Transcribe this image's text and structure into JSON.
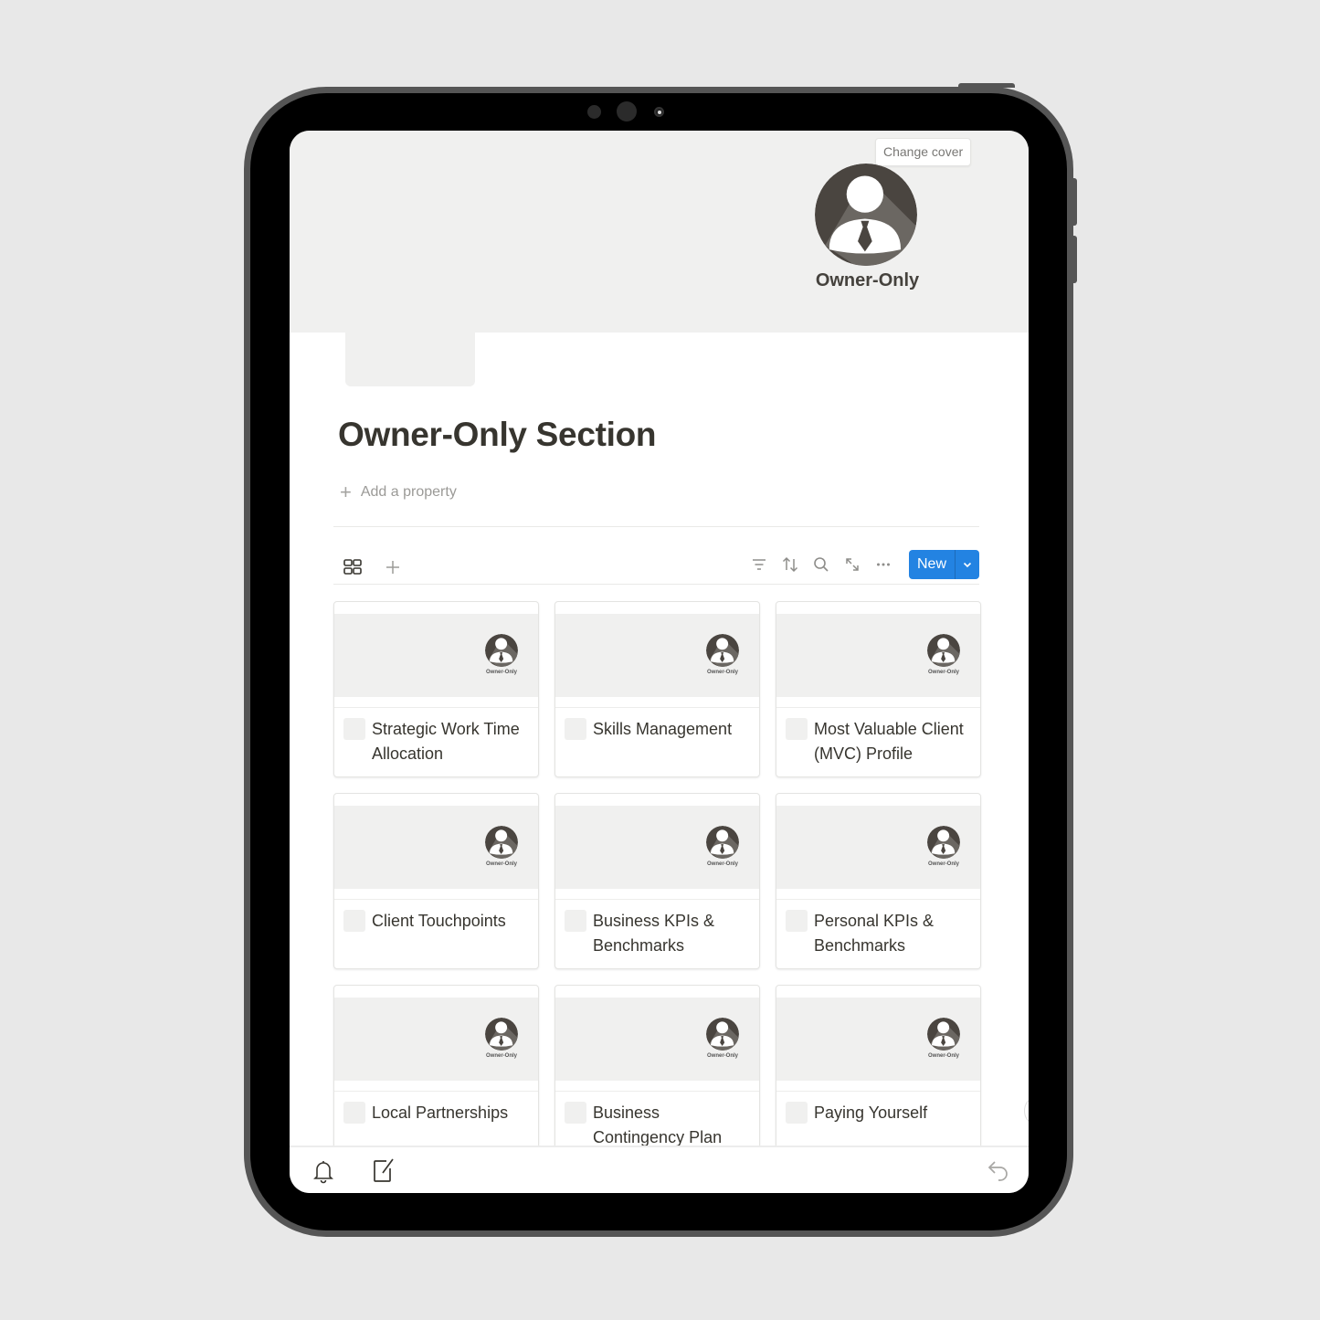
{
  "cover": {
    "change_cover_label": "Change cover",
    "logo_text": "Owner-Only",
    "logo_icon": "businessman-avatar-icon"
  },
  "page": {
    "title": "Owner-Only Section",
    "add_property_label": "Add a property"
  },
  "toolbar": {
    "view_icon": "gallery-grid-icon",
    "add_view_icon": "plus-icon",
    "filter_icon": "filter-icon",
    "sort_icon": "sort-icon",
    "search_icon": "search-icon",
    "expand_icon": "expand-icon",
    "more_icon": "more-icon",
    "new_label": "New"
  },
  "cards": [
    {
      "title": "Strategic Work Time Allocation",
      "badge": "Owner-Only"
    },
    {
      "title": "Skills Management",
      "badge": "Owner-Only"
    },
    {
      "title": "Most Valuable Client (MVC) Profile",
      "badge": "Owner-Only"
    },
    {
      "title": "Client Touchpoints",
      "badge": "Owner-Only"
    },
    {
      "title": "Business KPIs & Benchmarks",
      "badge": "Owner-Only"
    },
    {
      "title": "Personal KPIs & Benchmarks",
      "badge": "Owner-Only"
    },
    {
      "title": "Local Partnerships",
      "badge": "Owner-Only"
    },
    {
      "title": "Business Contingency Plan",
      "badge": "Owner-Only"
    },
    {
      "title": "Paying Yourself",
      "badge": "Owner-Only"
    }
  ],
  "bottom_bar": {
    "bell_icon": "bell-icon",
    "compose_icon": "compose-icon",
    "undo_icon": "undo-icon"
  },
  "colors": {
    "accent": "#2383e2",
    "cover_bg": "#f0f0ef",
    "text": "#37352f",
    "muted": "#9b9a97",
    "device_frame": "#555555"
  }
}
